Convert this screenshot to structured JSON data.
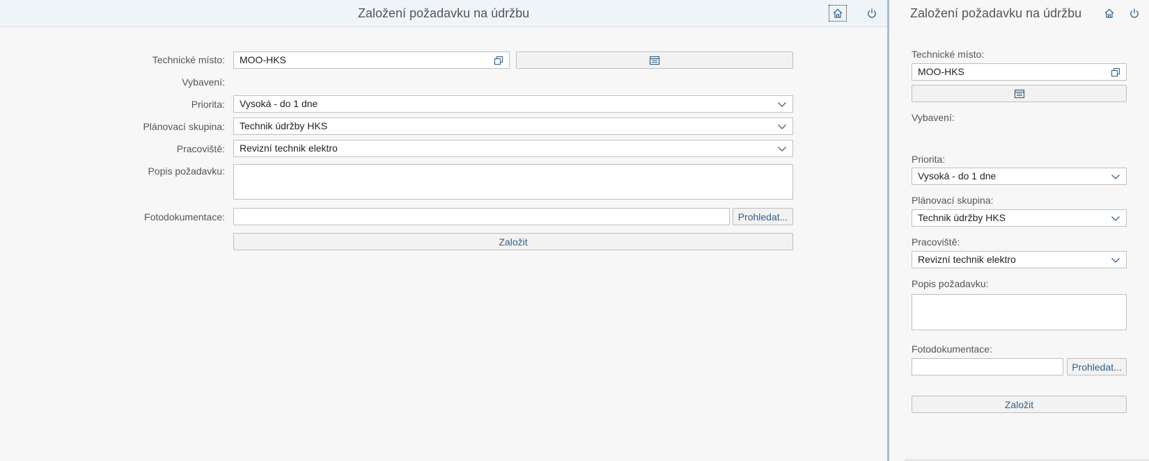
{
  "app": {
    "title": "Založení požadavku na údržbu"
  },
  "header": {
    "home_icon": "home-icon",
    "power_icon": "power-icon"
  },
  "form": {
    "labels": {
      "technicke_misto": "Technické místo:",
      "vybaveni": "Vybavení:",
      "priorita": "Priorita:",
      "planovaci_skupina": "Plánovací skupina:",
      "pracoviste": "Pracoviště:",
      "popis": "Popis požadavku:",
      "fotodokumentace": "Fotodokumentace:"
    },
    "values": {
      "technicke_misto": "MOO-HKS",
      "priorita": "Vysoká - do 1 dne",
      "planovaci_skupina": "Technik údržby HKS",
      "pracoviste": "Revizní technik elektro",
      "popis": "",
      "fotodokumentace": ""
    },
    "buttons": {
      "browse": "Prohledat...",
      "submit": "Založit"
    },
    "icons": {
      "value_help": "value-help-icon",
      "catalog": "catalog-icon",
      "dropdown": "chevron-down-icon"
    }
  },
  "colors": {
    "header_bg": "#eff4f9",
    "splitter": "#a9bfd3",
    "button_text": "#346187"
  }
}
